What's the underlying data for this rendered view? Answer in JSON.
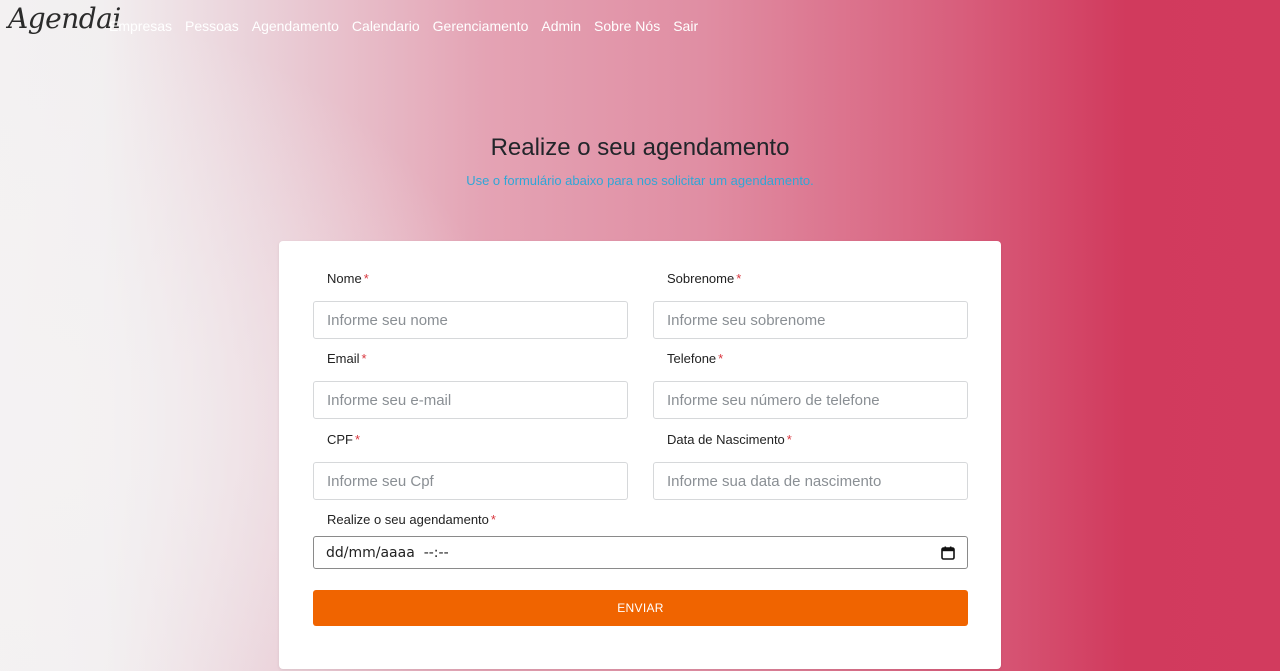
{
  "navbar": {
    "logo_text": "Agendai",
    "links": [
      "Empresas",
      "Pessoas",
      "Agendamento",
      "Calendario",
      "Gerenciamento",
      "Admin",
      "Sobre Nós",
      "Sair"
    ]
  },
  "header": {
    "title": "Realize o seu agendamento",
    "subtitle": "Use o formulário abaixo para nos solicitar um agendamento."
  },
  "form": {
    "required_mark": "*",
    "fields": {
      "nome": {
        "label": "Nome",
        "placeholder": "Informe seu nome",
        "value": ""
      },
      "sobrenome": {
        "label": "Sobrenome",
        "placeholder": "Informe seu sobrenome",
        "value": ""
      },
      "email": {
        "label": "Email",
        "placeholder": "Informe seu e-mail",
        "value": ""
      },
      "telefone": {
        "label": "Telefone",
        "placeholder": "Informe seu número de telefone",
        "value": ""
      },
      "cpf": {
        "label": "CPF",
        "placeholder": "Informe seu Cpf",
        "value": ""
      },
      "nascimento": {
        "label": "Data de Nascimento",
        "placeholder": "Informe sua data de nascimento",
        "value": ""
      },
      "agendamento": {
        "label": "Realize o seu agendamento",
        "display": "dd/mm/aaaa  --:--"
      }
    },
    "submit_label": "ENVIAR"
  },
  "colors": {
    "accent_button": "#f06400",
    "subtitle": "#31a6d6",
    "required": "#d9363e",
    "gradient_end": "#d13a5d"
  },
  "icons": {
    "datetime_picker": "calendar-icon"
  }
}
